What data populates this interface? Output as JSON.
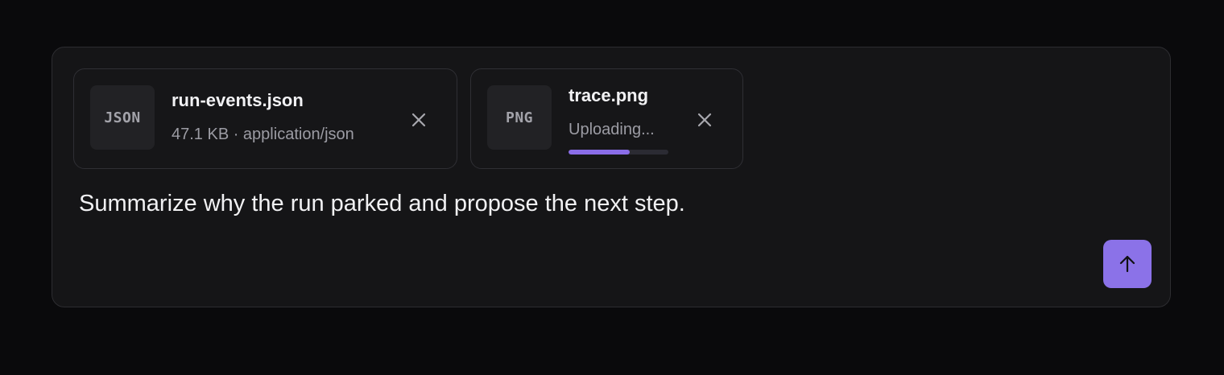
{
  "attachments": [
    {
      "thumb_label": "JSON",
      "name": "run-events.json",
      "meta": "47.1 KB · application/json",
      "icon": "close-icon"
    },
    {
      "thumb_label": "PNG",
      "name": "trace.png",
      "meta": "Uploading...",
      "progress": 0.61,
      "icon": "close-icon"
    }
  ],
  "prompt": {
    "text": "Summarize why the run parked and propose the next step."
  },
  "send": {
    "icon": "arrow-up-icon"
  },
  "colors": {
    "accent": "#8b72e8",
    "background": "#0a0a0c",
    "panel": "#151517"
  }
}
